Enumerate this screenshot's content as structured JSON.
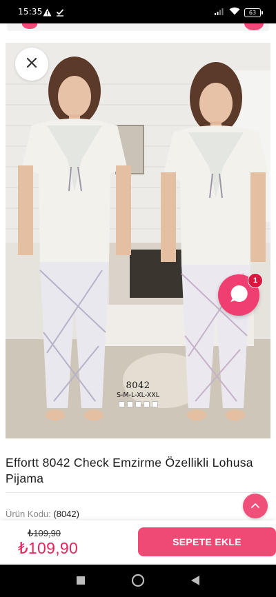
{
  "status_bar": {
    "time": "15:35",
    "battery": "63",
    "icons": [
      "warning-icon",
      "download-done-icon",
      "signal-icon",
      "wifi-icon",
      "battery-icon"
    ]
  },
  "product": {
    "image_code": "8042",
    "image_sizes": "S-M-L-XL-XXL",
    "title": "Effortt 8042 Check Emzirme Özellikli Lohusa Pijama",
    "code_label": "Ürün Kodu:",
    "code_value": "(8042)"
  },
  "chat": {
    "badge_count": "1"
  },
  "cart": {
    "old_price": "₺109,90",
    "new_price": "₺109,90",
    "button_label": "SEPETE EKLE"
  },
  "colors": {
    "accent": "#ef4a76",
    "price": "#e8245c"
  },
  "nav": {
    "icons": [
      "recents-icon",
      "home-icon",
      "back-icon"
    ]
  }
}
